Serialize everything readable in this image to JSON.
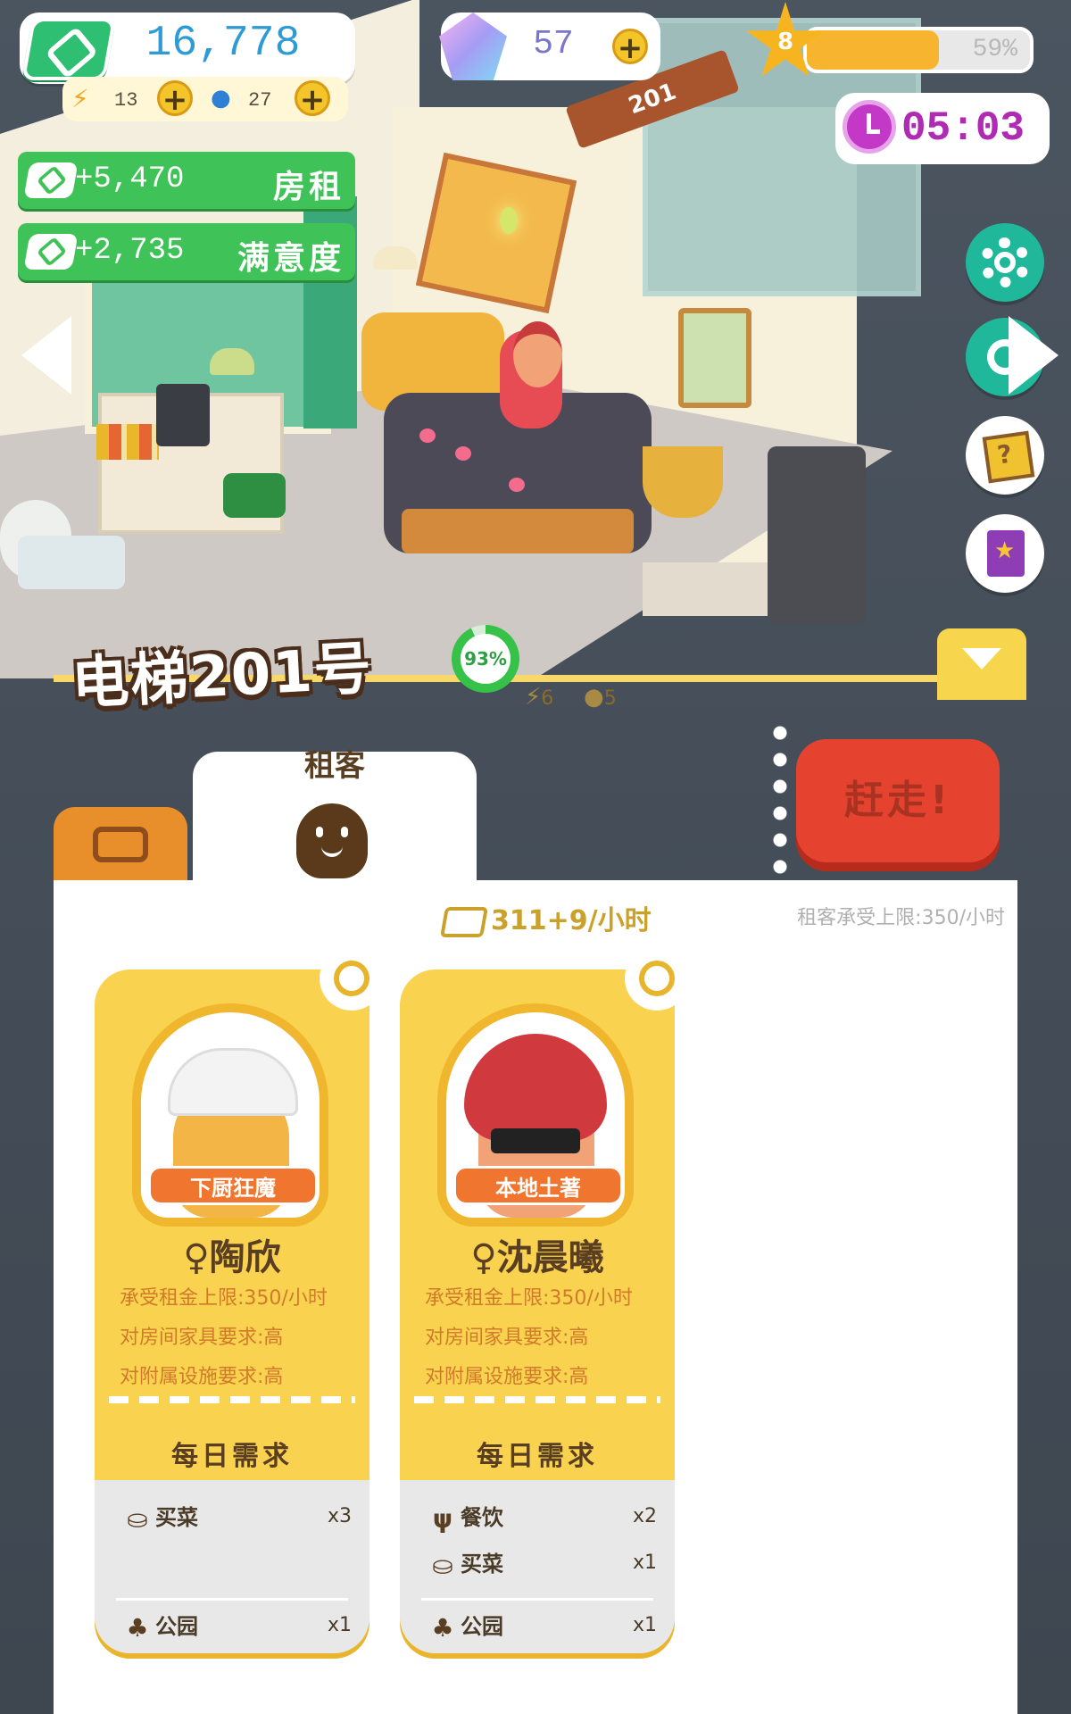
{
  "hud": {
    "money": "16,778",
    "energy": "13",
    "water": "27",
    "gems": "57",
    "level": "8",
    "xp_percent": 59,
    "xp_label": "59%",
    "timer": "05:03"
  },
  "income": [
    {
      "amount": "+5,470",
      "label": "房租"
    },
    {
      "amount": "+2,735",
      "label": "满意度"
    }
  ],
  "scene": {
    "room_sign": "201"
  },
  "room": {
    "title": "电梯201号",
    "satisfaction_percent": 93,
    "satisfaction_label": "93%",
    "energy_cost": "6",
    "water_cost": "5",
    "tab_label": "租客",
    "evict_label": "赶走!",
    "rent_rate": "311+9/小时",
    "rent_limit": "租客承受上限:350/小时"
  },
  "tenants": [
    {
      "tag": "下厨狂魔",
      "gender_icon": "♀",
      "name": "陶欣",
      "rent_cap": "承受租金上限:350/小时",
      "furniture_req": "对房间家具要求:高",
      "facility_req": "对附属设施要求:高",
      "daily_title": "每日需求",
      "needs": [
        {
          "icon": "basket-icon",
          "label": "买菜",
          "count": "x3"
        },
        {
          "icon": "park-icon",
          "label": "公园",
          "count": "x1"
        }
      ]
    },
    {
      "tag": "本地土著",
      "gender_icon": "♀",
      "name": "沈晨曦",
      "rent_cap": "承受租金上限:350/小时",
      "furniture_req": "对房间家具要求:高",
      "facility_req": "对附属设施要求:高",
      "daily_title": "每日需求",
      "needs": [
        {
          "icon": "dining-icon",
          "label": "餐饮",
          "count": "x2"
        },
        {
          "icon": "basket-icon",
          "label": "买菜",
          "count": "x1"
        },
        {
          "icon": "park-icon",
          "label": "公园",
          "count": "x1"
        }
      ]
    }
  ],
  "colors": {
    "accent_yellow": "#f8cb3c",
    "money_green": "#3fc257",
    "evict_red": "#e5432f",
    "timer_purple": "#b02bb4"
  }
}
